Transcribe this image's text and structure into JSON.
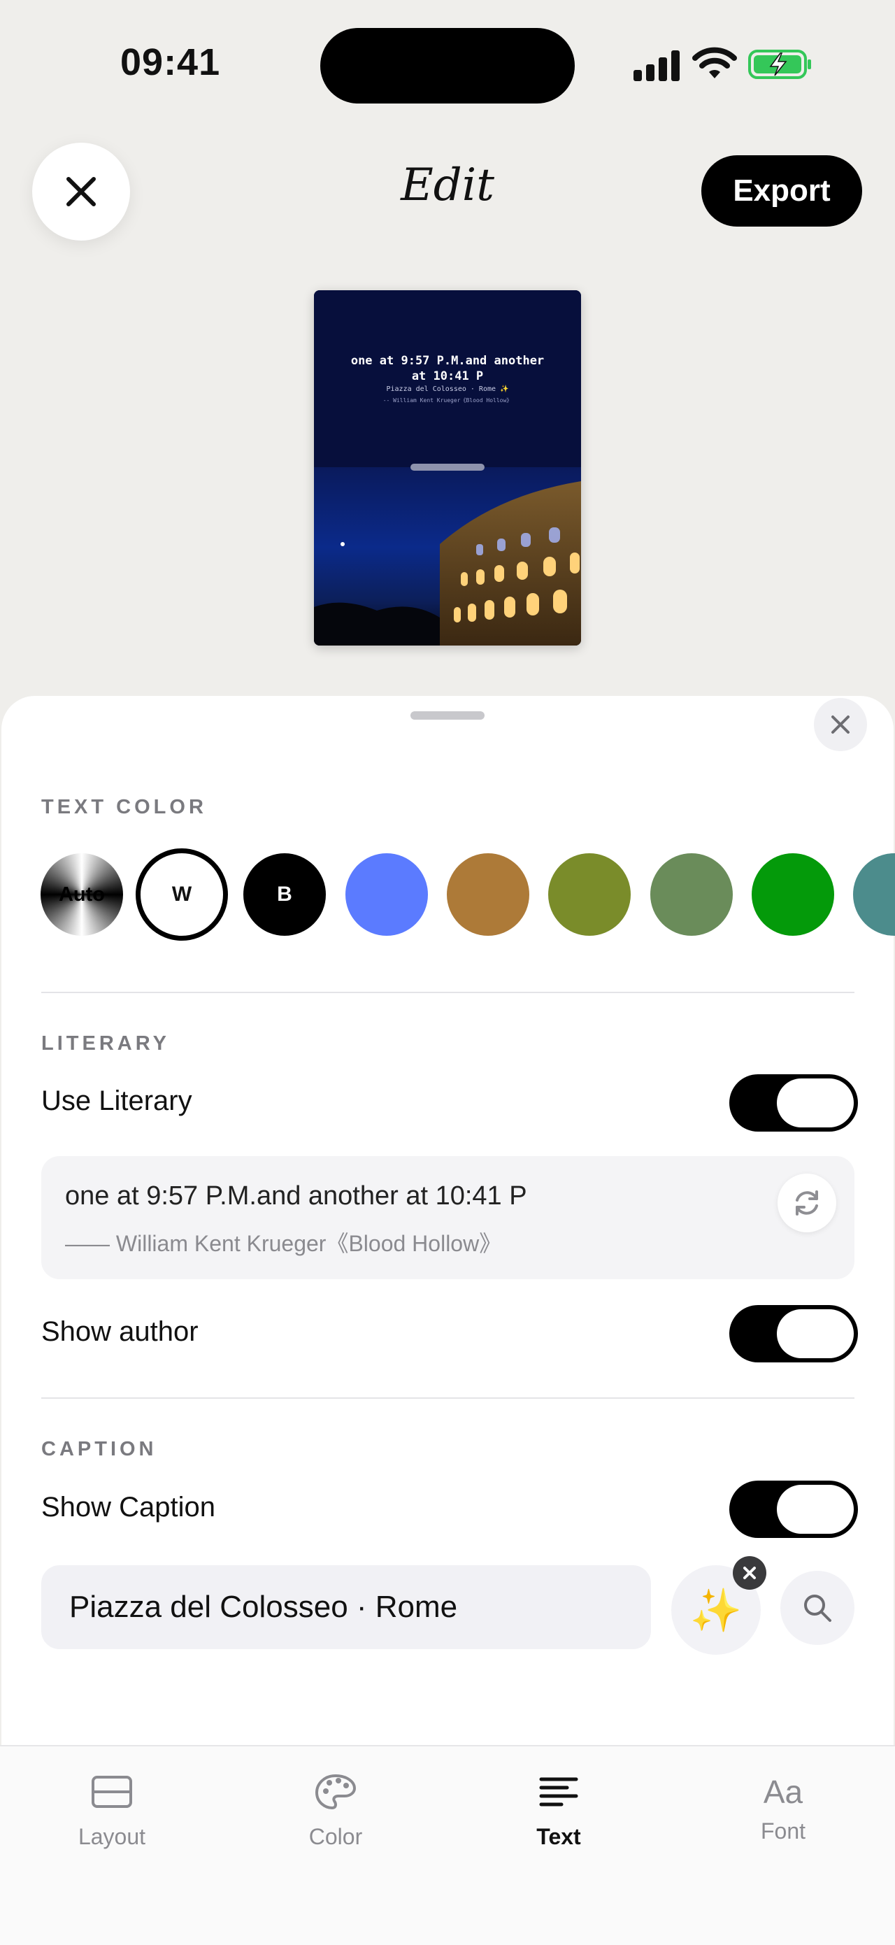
{
  "status_bar": {
    "time": "09:41"
  },
  "header": {
    "title": "Edit",
    "export_label": "Export"
  },
  "preview": {
    "quote": "one at 9:57 P.M.and another at 10:41 P",
    "caption": "Piazza del Colosseo · Rome ✨",
    "author": "-- William Kent Krueger《Blood Hollow》"
  },
  "text_color": {
    "section_label": "TEXT COLOR",
    "swatches": [
      {
        "label": "Auto",
        "color": "auto"
      },
      {
        "label": "W",
        "color": "#ffffff"
      },
      {
        "label": "B",
        "color": "#000000"
      },
      {
        "label": "",
        "color": "#5b7bff"
      },
      {
        "label": "",
        "color": "#ad7a38"
      },
      {
        "label": "",
        "color": "#7a8c2a"
      },
      {
        "label": "",
        "color": "#6a8c5a"
      },
      {
        "label": "",
        "color": "#049a0a"
      },
      {
        "label": "",
        "color": "#4c8c8c"
      }
    ]
  },
  "literary": {
    "section_label": "LITERARY",
    "use_literary_label": "Use Literary",
    "use_literary_on": true,
    "quote_text": "one at 9:57 P.M.and another at 10:41 P",
    "quote_author": "—— William Kent Krueger《Blood Hollow》",
    "show_author_label": "Show author",
    "show_author_on": true
  },
  "caption": {
    "section_label": "CAPTION",
    "show_caption_label": "Show Caption",
    "show_caption_on": true,
    "value": "Piazza del Colosseo · Rome",
    "sparkle_icon": "✨"
  },
  "tabs": [
    {
      "label": "Layout",
      "icon": "layout-icon",
      "active": false
    },
    {
      "label": "Color",
      "icon": "palette-icon",
      "active": false
    },
    {
      "label": "Text",
      "icon": "text-align-icon",
      "active": true
    },
    {
      "label": "Font",
      "icon": "Aa",
      "active": false
    }
  ]
}
